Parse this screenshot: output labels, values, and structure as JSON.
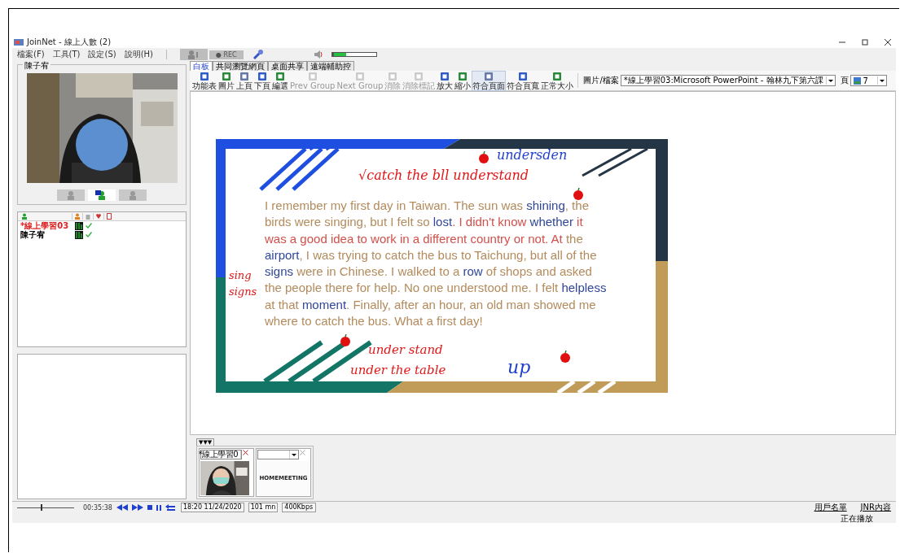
{
  "window": {
    "title": "JoinNet - 線上人數 (2)"
  },
  "menu": [
    "檔案(F)",
    "工具(T)",
    "設定(S)",
    "說明(H)"
  ],
  "rec_button": {
    "label": "● REC",
    "disabled": true
  },
  "volume": {
    "level": 0.3
  },
  "video_panel": {
    "title": "陳子宥",
    "buttons": [
      {
        "selected": false
      },
      {
        "selected": true
      },
      {
        "selected": false
      }
    ]
  },
  "user_list": {
    "rows": [
      {
        "name": "*線上學習03",
        "highlighted": true,
        "checked": true
      },
      {
        "name": "陳子宥",
        "highlighted": false,
        "checked": true
      }
    ]
  },
  "tabs": [
    {
      "label": "白板",
      "selected": true
    },
    {
      "label": "共同瀏覽網頁",
      "selected": false
    },
    {
      "label": "桌面共享",
      "selected": false
    },
    {
      "label": "遠端輔助控",
      "selected": false
    }
  ],
  "toolbar": [
    {
      "label": "功能表",
      "disabled": false,
      "selected": false
    },
    {
      "label": "圖片",
      "disabled": false,
      "selected": false
    },
    {
      "label": "上頁",
      "disabled": false,
      "selected": false
    },
    {
      "label": "下頁",
      "disabled": false,
      "selected": false
    },
    {
      "label": "編選",
      "disabled": false,
      "selected": false
    },
    {
      "label": "Prev Group",
      "disabled": true,
      "selected": false
    },
    {
      "label": "Next Group",
      "disabled": true,
      "selected": false
    },
    {
      "label": "消除",
      "disabled": true,
      "selected": false
    },
    {
      "label": "消除標記",
      "disabled": true,
      "selected": false
    },
    {
      "label": "放大",
      "disabled": false,
      "selected": false
    },
    {
      "label": "縮小",
      "disabled": false,
      "selected": false
    },
    {
      "label": "符合頁面",
      "disabled": false,
      "selected": true
    },
    {
      "label": "符合頁寬",
      "disabled": false,
      "selected": false
    },
    {
      "label": "正常大小",
      "disabled": false,
      "selected": false
    }
  ],
  "file_picker": {
    "label": "圖片/檔案",
    "value": "*線上學習03:Microsoft PowerPoint - 翰林九下第六課"
  },
  "page_picker": {
    "label": "頁",
    "value": "7"
  },
  "slide": {
    "paragraph": [
      {
        "text": "I remember my first day in Taiwan. The sun was ",
        "color": "#b38b5d"
      },
      {
        "text": "shining",
        "color": "#2f4699"
      },
      {
        "text": ", the birds were singing, but I felt so ",
        "color": "#b38b5d"
      },
      {
        "text": "lost",
        "color": "#2f4699"
      },
      {
        "text": ". I didn't know ",
        "color": "#d2504b"
      },
      {
        "text": "whether",
        "color": "#2f4699"
      },
      {
        "text": " it was a good idea to work in a different country or not. At",
        "color": "#d2504b"
      },
      {
        "text": " the ",
        "color": "#b38b5d"
      },
      {
        "text": "airport",
        "color": "#2f4699"
      },
      {
        "text": ", I was trying to catch the bus to Taichung, but all of the ",
        "color": "#b38b5d"
      },
      {
        "text": "signs",
        "color": "#2f4699"
      },
      {
        "text": " were in Chinese. I walked to a ",
        "color": "#b38b5d"
      },
      {
        "text": "row",
        "color": "#2f4699"
      },
      {
        "text": " of shops and asked the people there for help. No one understood me. I felt ",
        "color": "#b38b5d"
      },
      {
        "text": "helpless",
        "color": "#2f4699"
      },
      {
        "text": " at that ",
        "color": "#b38b5d"
      },
      {
        "text": "moment",
        "color": "#2f4699"
      },
      {
        "text": ". Finally, after an hour, an old man showed me where to catch the bus. What a first day!",
        "color": "#b38b5d"
      }
    ],
    "notes": [
      {
        "text": "undersden",
        "color": "#1f3fd0",
        "kind": "top-right"
      },
      {
        "text": "√catch the bll understand",
        "color": "#e01818",
        "kind": "top"
      },
      {
        "text": "sing",
        "color": "#e01818",
        "kind": "left1"
      },
      {
        "text": "signs",
        "color": "#e01818",
        "kind": "left2"
      },
      {
        "text": "under stand",
        "color": "#e01818",
        "kind": "bottom1"
      },
      {
        "text": "under the table",
        "color": "#e01818",
        "kind": "bottom2"
      },
      {
        "text": "up",
        "color": "#1f3fd0",
        "kind": "bottom-right"
      }
    ]
  },
  "thumbnails": {
    "toggle": "▼▼▼",
    "items": [
      {
        "kind": "camera",
        "value": "*線上學習0"
      },
      {
        "kind": "logo",
        "value": "",
        "logo": "HOMEMEETING"
      }
    ]
  },
  "status_bar": {
    "playback": {
      "level": 0.42
    },
    "elapsed": "00:35:38",
    "datetime": "18:20 11/24/2020",
    "duration": "101 mn",
    "bitrate": "400Kbps",
    "links": [
      "用戶名單",
      "JNR內容"
    ],
    "state": "正在播放"
  }
}
